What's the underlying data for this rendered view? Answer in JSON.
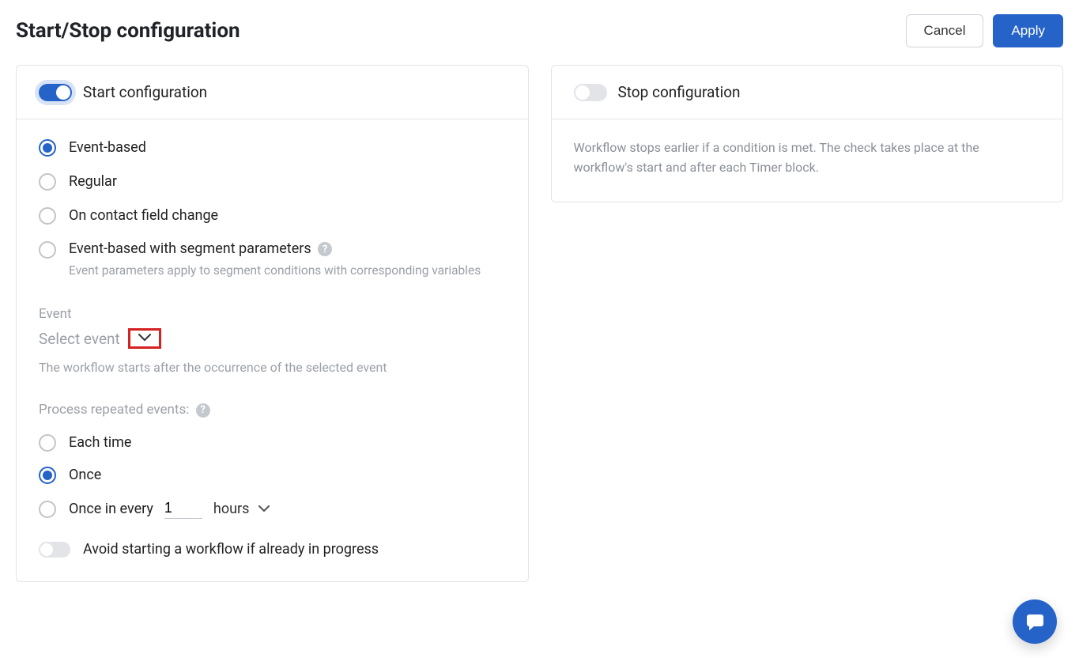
{
  "header": {
    "title": "Start/Stop configuration",
    "cancel": "Cancel",
    "apply": "Apply"
  },
  "start": {
    "title": "Start configuration",
    "toggleOn": true,
    "modes": {
      "eventBased": "Event-based",
      "regular": "Regular",
      "onContactFieldChange": "On contact field change",
      "eventBasedSegment": "Event-based with segment parameters",
      "eventBasedSegmentHint": "Event parameters apply to segment conditions with corresponding variables"
    },
    "eventLabel": "Event",
    "eventSelectPlaceholder": "Select event",
    "eventHint": "The workflow starts after the occurrence of the selected event",
    "repeatLabel": "Process repeated events:",
    "repeat": {
      "eachTime": "Each time",
      "once": "Once",
      "onceInEvery": "Once in every",
      "intervalValue": "1",
      "intervalUnit": "hours"
    },
    "avoidLabel": "Avoid starting a workflow if already in progress"
  },
  "stop": {
    "title": "Stop configuration",
    "toggleOn": false,
    "description": "Workflow stops earlier if a condition is met. The check takes place at the workflow's start and after each Timer block."
  }
}
